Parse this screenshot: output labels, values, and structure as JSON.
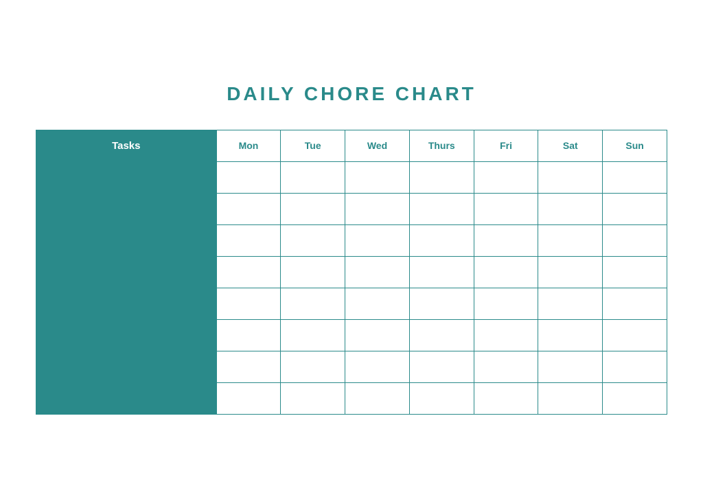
{
  "title": "DAILY CHORE CHART",
  "header": {
    "tasks_label": "Tasks",
    "days": [
      "Mon",
      "Tue",
      "Wed",
      "Thurs",
      "Fri",
      "Sat",
      "Sun"
    ]
  },
  "rows": [
    {
      "id": 1
    },
    {
      "id": 2
    },
    {
      "id": 3
    },
    {
      "id": 4
    },
    {
      "id": 5
    },
    {
      "id": 6
    },
    {
      "id": 7
    },
    {
      "id": 8
    }
  ],
  "colors": {
    "teal": "#2a8a8a",
    "white": "#ffffff"
  }
}
